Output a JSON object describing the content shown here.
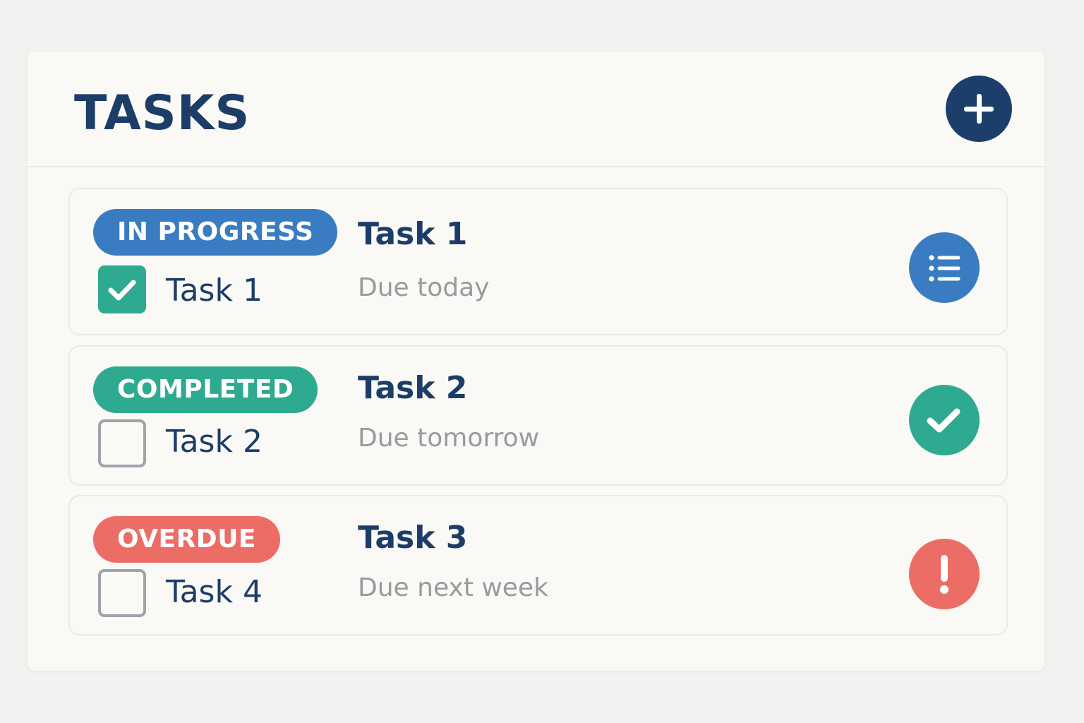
{
  "header": {
    "title": "TASKS",
    "add_icon": "plus-icon"
  },
  "colors": {
    "title": "#1c3d68",
    "add_button": "#1b3e6b",
    "in_progress": "#3a7cc2",
    "completed": "#2eaa90",
    "overdue": "#ec6d66",
    "due_text": "#969b9f"
  },
  "tasks": [
    {
      "status": "IN PROGRESS",
      "status_color": "#3a7cc2",
      "checkbox_label": "Task 1",
      "checked": true,
      "title": "Task 1",
      "due": "Due today",
      "action_icon": "list-icon"
    },
    {
      "status": "COMPLETED",
      "status_color": "#2eaa90",
      "checkbox_label": "Task 2",
      "checked": false,
      "title": "Task 2",
      "due": "Due tomorrow",
      "action_icon": "check-circle-icon"
    },
    {
      "status": "OVERDUE",
      "status_color": "#ec6d66",
      "checkbox_label": "Task 4",
      "checked": false,
      "title": "Task 3",
      "due": "Due next week",
      "action_icon": "alert-icon"
    }
  ]
}
